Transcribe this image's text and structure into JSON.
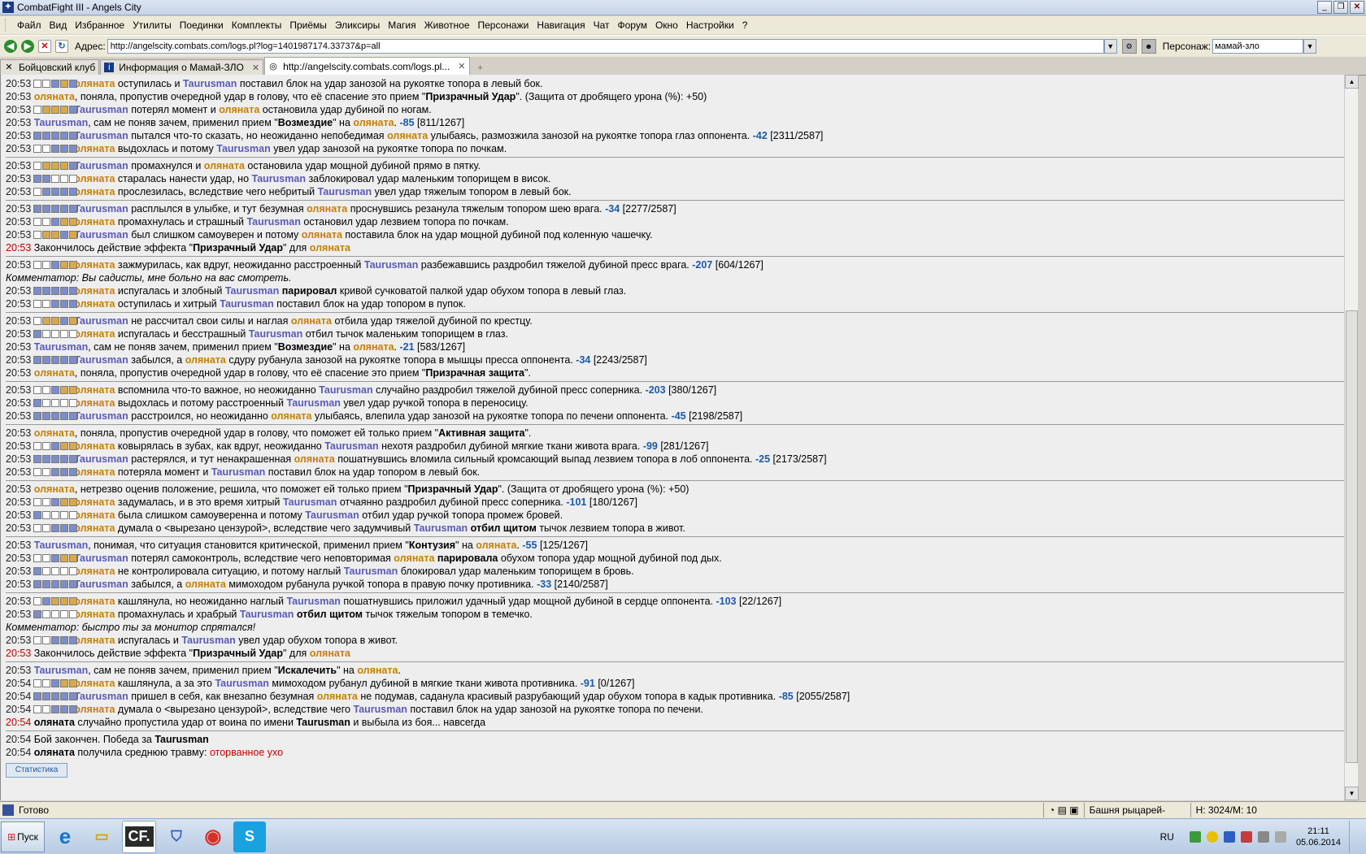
{
  "window": {
    "title": "CombatFight III - Angels City"
  },
  "menu": [
    "Файл",
    "Вид",
    "Избранное",
    "Утилиты",
    "Поединки",
    "Комплекты",
    "Приёмы",
    "Эликсиры",
    "Магия",
    "Животное",
    "Персонажи",
    "Навигация",
    "Чат",
    "Форум",
    "Окно",
    "Настройки",
    "?"
  ],
  "address": {
    "label": "Адрес:",
    "url": "http://angelscity.combats.com/logs.pl?log=1401987174.33737&p=all"
  },
  "character": {
    "label": "Персонаж:",
    "value": "мамай-зло"
  },
  "tabs": [
    {
      "label": "Бойцовский клуб"
    },
    {
      "label": "Информация о Мамай-ЗЛО"
    },
    {
      "label": "http://angelscity.combats.com/logs.pl..."
    }
  ],
  "log": {
    "groups": [
      [
        {
          "t": "20:53",
          "b": [
            0,
            0,
            1,
            2,
            1
          ],
          "h": "<span class='p1'>оляната</span> оступилась и <span class='p2'>Taurusman</span> поставил блок на удар занозой на рукоятке топора в левый бок."
        },
        {
          "t": "20:53",
          "h": "<span class='p1'>оляната</span>, поняла, пропустив очередной удар в голову, что её спасение это прием \"<b>Призрачный Удар</b>\". (Защита от дробящего урона (%): +50)"
        },
        {
          "t": "20:53",
          "b": [
            0,
            2,
            2,
            2,
            1
          ],
          "h": "<span class='p2'>Taurusman</span> потерял момент и <span class='p1'>оляната</span> остановила удар дубиной по ногам."
        },
        {
          "t": "20:53",
          "h": "<span class='p2'>Taurusman</span>, сам не поняв зачем, применил прием \"<b>Возмездие</b>\" на <span class='p1'>оляната</span>. <span class='dmg'>-85</span> [811/1267]"
        },
        {
          "t": "20:53",
          "b": [
            1,
            1,
            1,
            1,
            1
          ],
          "h": "<span class='p2'>Taurusman</span> пытался что-то сказать, но неожиданно непобедимая <span class='p1'>оляната</span> улыбаясь, размозжила занозой на рукоятке топора глаз оппонента. <span class='dmg'>-42</span> [2311/2587]"
        },
        {
          "t": "20:53",
          "b": [
            0,
            0,
            1,
            1,
            1
          ],
          "h": "<span class='p1'>оляната</span> выдохлась и потому <span class='p2'>Taurusman</span> увел удар занозой на рукоятке топора по почкам."
        }
      ],
      [
        {
          "t": "20:53",
          "b": [
            0,
            2,
            2,
            2,
            1
          ],
          "h": "<span class='p2'>Taurusman</span> промахнулся и <span class='p1'>оляната</span> остановила удар мощной дубиной прямо в пятку."
        },
        {
          "t": "20:53",
          "b": [
            1,
            1,
            0,
            0,
            0
          ],
          "h": "<span class='p1'>оляната</span> старалась нанести удар, но <span class='p2'>Taurusman</span> заблокировал удар маленьким топорищем в висок."
        },
        {
          "t": "20:53",
          "b": [
            0,
            1,
            1,
            1,
            1
          ],
          "h": "<span class='p1'>оляната</span> прослезилась, вследствие чего небритый <span class='p2'>Taurusman</span> увел удар тяжелым топором в левый бок."
        }
      ],
      [
        {
          "t": "20:53",
          "b": [
            1,
            1,
            1,
            1,
            1
          ],
          "h": "<span class='p2'>Taurusman</span> расплылся в улыбке, и тут безумная <span class='p1'>оляната</span> проснувшись резанула тяжелым топором шею врага. <span class='dmg'>-34</span> [2277/2587]"
        },
        {
          "t": "20:53",
          "b": [
            0,
            0,
            1,
            2,
            2
          ],
          "h": "<span class='p1'>оляната</span> промахнулась и страшный <span class='p2'>Taurusman</span> остановил удар лезвием топора по почкам."
        },
        {
          "t": "20:53",
          "b": [
            0,
            2,
            2,
            1,
            2
          ],
          "h": "<span class='p2'>Taurusman</span> был слишком самоуверен и потому <span class='p1'>оляната</span> поставила блок на удар мощной дубиной под коленную чашечку."
        },
        {
          "t": "20:53",
          "red": true,
          "h": "Закончилось действие эффекта \"<b>Призрачный Удар</b>\" для <span class='p1'>оляната</span>"
        }
      ],
      [
        {
          "t": "20:53",
          "b": [
            0,
            0,
            1,
            2,
            2
          ],
          "h": "<span class='p1'>оляната</span> зажмурилась, как вдруг, неожиданно расстроенный <span class='p2'>Taurusman</span> разбежавшись раздробил тяжелой дубиной пресс врага. <span class='dmg'>-207</span> [604/1267]"
        },
        {
          "cmt": true,
          "h": "Комментатор: Вы садисты, мне больно на вас смотреть."
        },
        {
          "t": "20:53",
          "b": [
            1,
            1,
            1,
            1,
            1
          ],
          "h": "<span class='p1'>оляната</span> испугалась и злобный <span class='p2'>Taurusman</span> <b>парировал</b> кривой сучковатой палкой удар обухом топора в левый глаз."
        },
        {
          "t": "20:53",
          "b": [
            0,
            0,
            1,
            1,
            1
          ],
          "h": "<span class='p1'>оляната</span> оступилась и хитрый <span class='p2'>Taurusman</span> поставил блок на удар топором в пупок."
        }
      ],
      [
        {
          "t": "20:53",
          "b": [
            0,
            2,
            2,
            1,
            2
          ],
          "h": "<span class='p2'>Taurusman</span> не рассчитал свои силы и наглая <span class='p1'>оляната</span> отбила удар тяжелой дубиной по крестцу."
        },
        {
          "t": "20:53",
          "b": [
            1,
            0,
            0,
            0,
            0
          ],
          "h": "<span class='p1'>оляната</span> испугалась и бесстрашный <span class='p2'>Taurusman</span> отбил тычок маленьким топорищем в глаз."
        },
        {
          "t": "20:53",
          "h": "<span class='p2'>Taurusman</span>, сам не поняв зачем, применил прием \"<b>Возмездие</b>\" на <span class='p1'>оляната</span>. <span class='dmg'>-21</span> [583/1267]"
        },
        {
          "t": "20:53",
          "b": [
            1,
            1,
            1,
            1,
            1
          ],
          "h": "<span class='p2'>Taurusman</span> забылся, а <span class='p1'>оляната</span> сдуру рубанула занозой на рукоятке топора в мышцы пресса оппонента. <span class='dmg'>-34</span> [2243/2587]"
        },
        {
          "t": "20:53",
          "h": "<span class='p1'>оляната</span>, поняла, пропустив очередной удар в голову, что её спасение это прием \"<b>Призрачная защита</b>\"."
        }
      ],
      [
        {
          "t": "20:53",
          "b": [
            0,
            0,
            1,
            2,
            2
          ],
          "h": "<span class='p1'>оляната</span> вспомнила что-то важное, но неожиданно <span class='p2'>Taurusman</span> случайно раздробил тяжелой дубиной пресс соперника. <span class='dmg'>-203</span> [380/1267]"
        },
        {
          "t": "20:53",
          "b": [
            1,
            0,
            0,
            0,
            0
          ],
          "h": "<span class='p1'>оляната</span> выдохлась и потому расстроенный <span class='p2'>Taurusman</span> увел удар ручкой топора в переносицу."
        },
        {
          "t": "20:53",
          "b": [
            1,
            1,
            1,
            1,
            1
          ],
          "h": "<span class='p2'>Taurusman</span> расстроился, но неожиданно <span class='p1'>оляната</span> улыбаясь, влепила удар занозой на рукоятке топора по печени оппонента. <span class='dmg'>-45</span> [2198/2587]"
        }
      ],
      [
        {
          "t": "20:53",
          "h": "<span class='p1'>оляната</span>, поняла, пропустив очередной удар в голову, что поможет ей только прием \"<b>Активная защита</b>\"."
        },
        {
          "t": "20:53",
          "b": [
            0,
            0,
            1,
            2,
            2
          ],
          "h": "<span class='p1'>оляната</span> ковырялась в зубах, как вдруг, неожиданно <span class='p2'>Taurusman</span> нехотя раздробил дубиной мягкие ткани живота врага. <span class='dmg'>-99</span> [281/1267]"
        },
        {
          "t": "20:53",
          "b": [
            1,
            1,
            1,
            1,
            1
          ],
          "h": "<span class='p2'>Taurusman</span> растерялся, и тут ненакрашенная <span class='p1'>оляната</span> пошатнувшись вломила сильный кромсающий выпад лезвием топора в лоб оппонента. <span class='dmg'>-25</span> [2173/2587]"
        },
        {
          "t": "20:53",
          "b": [
            0,
            0,
            1,
            1,
            1
          ],
          "h": "<span class='p1'>оляната</span> потеряла момент и <span class='p2'>Taurusman</span> поставил блок на удар топором в левый бок."
        }
      ],
      [
        {
          "t": "20:53",
          "h": "<span class='p1'>оляната</span>, нетрезво оценив положение, решила, что поможет ей только прием \"<b>Призрачный Удар</b>\". (Защита от дробящего урона (%): +50)"
        },
        {
          "t": "20:53",
          "b": [
            0,
            0,
            1,
            2,
            2
          ],
          "h": "<span class='p1'>оляната</span> задумалась, и в это время хитрый <span class='p2'>Taurusman</span> отчаянно раздробил дубиной пресс соперника. <span class='dmg'>-101</span> [180/1267]"
        },
        {
          "t": "20:53",
          "b": [
            1,
            0,
            0,
            0,
            0
          ],
          "h": "<span class='p1'>оляната</span> была слишком самоуверенна и потому <span class='p2'>Taurusman</span> отбил удар ручкой топора промеж бровей."
        },
        {
          "t": "20:53",
          "b": [
            0,
            0,
            1,
            1,
            1
          ],
          "h": "<span class='p1'>оляната</span> думала о &lt;вырезано цензурой&gt;, вследствие чего задумчивый <span class='p2'>Taurusman</span> <b>отбил щитом</b> тычок лезвием топора в живот."
        }
      ],
      [
        {
          "t": "20:53",
          "h": "<span class='p2'>Taurusman</span>, понимая, что ситуация становится критической, применил прием \"<b>Контузия</b>\" на <span class='p1'>оляната</span>. <span class='dmg'>-55</span> [125/1267]"
        },
        {
          "t": "20:53",
          "b": [
            0,
            0,
            1,
            2,
            2
          ],
          "h": "<span class='p2'>Taurusman</span> потерял самоконтроль, вследствие чего неповторимая <span class='p1'>оляната</span> <b>парировала</b> обухом топора удар мощной дубиной под дых."
        },
        {
          "t": "20:53",
          "b": [
            1,
            0,
            0,
            0,
            0
          ],
          "h": "<span class='p1'>оляната</span> не контролировала ситуацию, и потому наглый <span class='p2'>Taurusman</span> блокировал удар маленьким топорищем в бровь."
        },
        {
          "t": "20:53",
          "b": [
            1,
            1,
            1,
            1,
            1
          ],
          "h": "<span class='p2'>Taurusman</span> забылся, а <span class='p1'>оляната</span> мимоходом рубанула ручкой топора в правую почку противника. <span class='dmg'>-33</span> [2140/2587]"
        }
      ],
      [
        {
          "t": "20:53",
          "b": [
            0,
            1,
            2,
            2,
            2
          ],
          "h": "<span class='p1'>оляната</span> кашлянула, но неожиданно наглый <span class='p2'>Taurusman</span> пошатнувшись приложил удачный удар мощной дубиной в сердце оппонента. <span class='dmg'>-103</span> [22/1267]"
        },
        {
          "t": "20:53",
          "b": [
            1,
            0,
            0,
            0,
            0
          ],
          "h": "<span class='p1'>оляната</span> промахнулась и храбрый <span class='p2'>Taurusman</span> <b>отбил щитом</b> тычок тяжелым топором в темечко."
        },
        {
          "cmt": true,
          "h": "Комментатор: быстро ты за монитор спрятался!"
        },
        {
          "t": "20:53",
          "b": [
            0,
            0,
            1,
            1,
            1
          ],
          "h": "<span class='p1'>оляната</span> испугалась и <span class='p2'>Taurusman</span> увел удар обухом топора в живот."
        },
        {
          "t": "20:53",
          "red": true,
          "h": "Закончилось действие эффекта \"<b>Призрачный Удар</b>\" для <span class='p1'>оляната</span>"
        }
      ],
      [
        {
          "t": "20:53",
          "h": "<span class='p2'>Taurusman</span>, сам не поняв зачем, применил прием \"<b>Искалечить</b>\" на <span class='p1'>оляната</span>."
        },
        {
          "t": "20:54",
          "b": [
            0,
            0,
            1,
            2,
            2
          ],
          "h": "<span class='p1'>оляната</span> кашлянула, а за это <span class='p2'>Taurusman</span> мимоходом рубанул дубиной в мягкие ткани живота противника. <span class='dmg'>-91</span> [0/1267]"
        },
        {
          "t": "20:54",
          "b": [
            1,
            1,
            1,
            1,
            1
          ],
          "h": "<span class='p2'>Taurusman</span> пришел в себя, как внезапно безумная <span class='p1'>оляната</span> не подумав, саданула красивый разрубающий удар обухом топора в кадык противника. <span class='dmg'>-85</span> [2055/2587]"
        },
        {
          "t": "20:54",
          "b": [
            0,
            0,
            1,
            1,
            1
          ],
          "h": "<span class='p1'>оляната</span> думала о &lt;вырезано цензурой&gt;, вследствие чего <span class='p2'>Taurusman</span> поставил блок на удар занозой на рукоятке топора по печени."
        },
        {
          "t": "20:54",
          "red": true,
          "h": "<b>оляната</b> случайно пропустила удар от воина по имени <b>Taurusman</b> и выбыла из боя... навсегда"
        }
      ],
      [
        {
          "t": "20:54",
          "h": "Бой закончен. Победа за <b>Taurusman</b>"
        },
        {
          "t": "20:54",
          "h": "<b>оляната</b> получила среднюю травму: <span class='redtxt'>оторванное ухо</span>"
        }
      ]
    ],
    "stat_button": "Статистика"
  },
  "status": {
    "text": "Готово",
    "zone": "Башня рыцарей-магов",
    "hp": "Н: 3024/М: 10"
  },
  "taskbar": {
    "start": "Пуск",
    "apps": [
      "ie-icon",
      "explorer-icon",
      "combats-icon",
      "shield-icon",
      "chrome-icon",
      "skype-icon"
    ],
    "active_app_label": "CF.",
    "lang": "RU",
    "time": "21:11",
    "date": "05.06.2014"
  }
}
